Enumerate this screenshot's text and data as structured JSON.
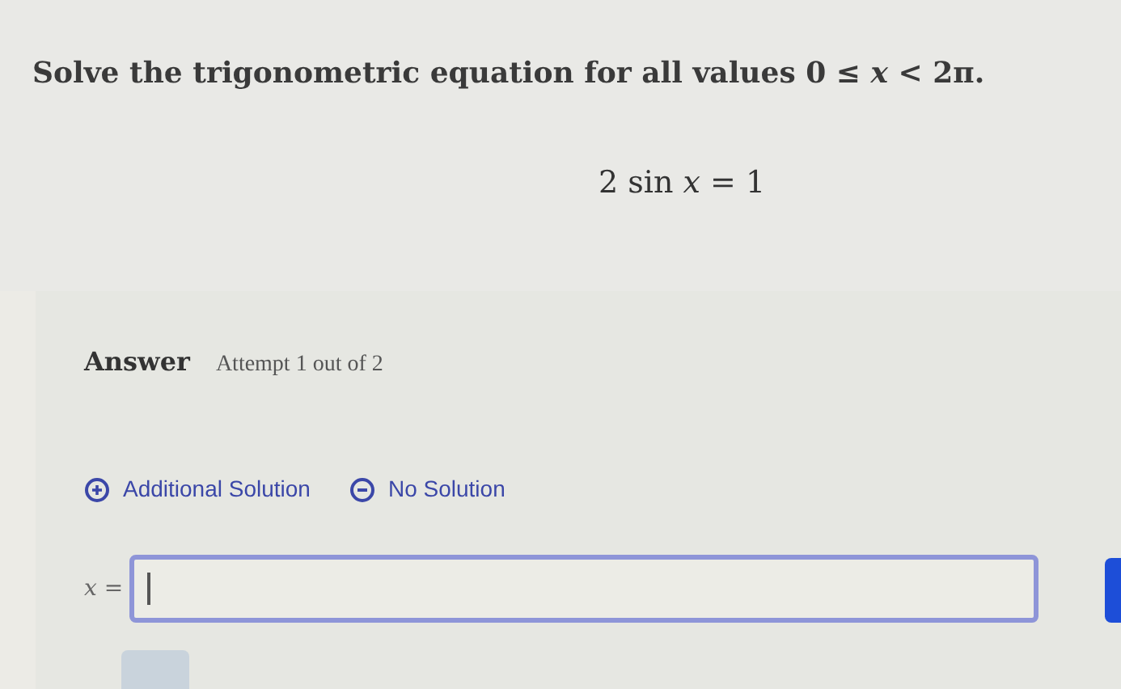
{
  "question": {
    "prompt": "Solve the trigonometric equation for all values 0 ≤ *x* < 2π.",
    "equation": "2 sin *x* = 1"
  },
  "answer": {
    "heading": "Answer",
    "attempt": "Attempt 1 out of 2",
    "actions": [
      {
        "kind": "add",
        "label": "Additional Solution"
      },
      {
        "kind": "none",
        "label": "No Solution"
      }
    ],
    "field": {
      "label": "*x* ="
    }
  }
}
